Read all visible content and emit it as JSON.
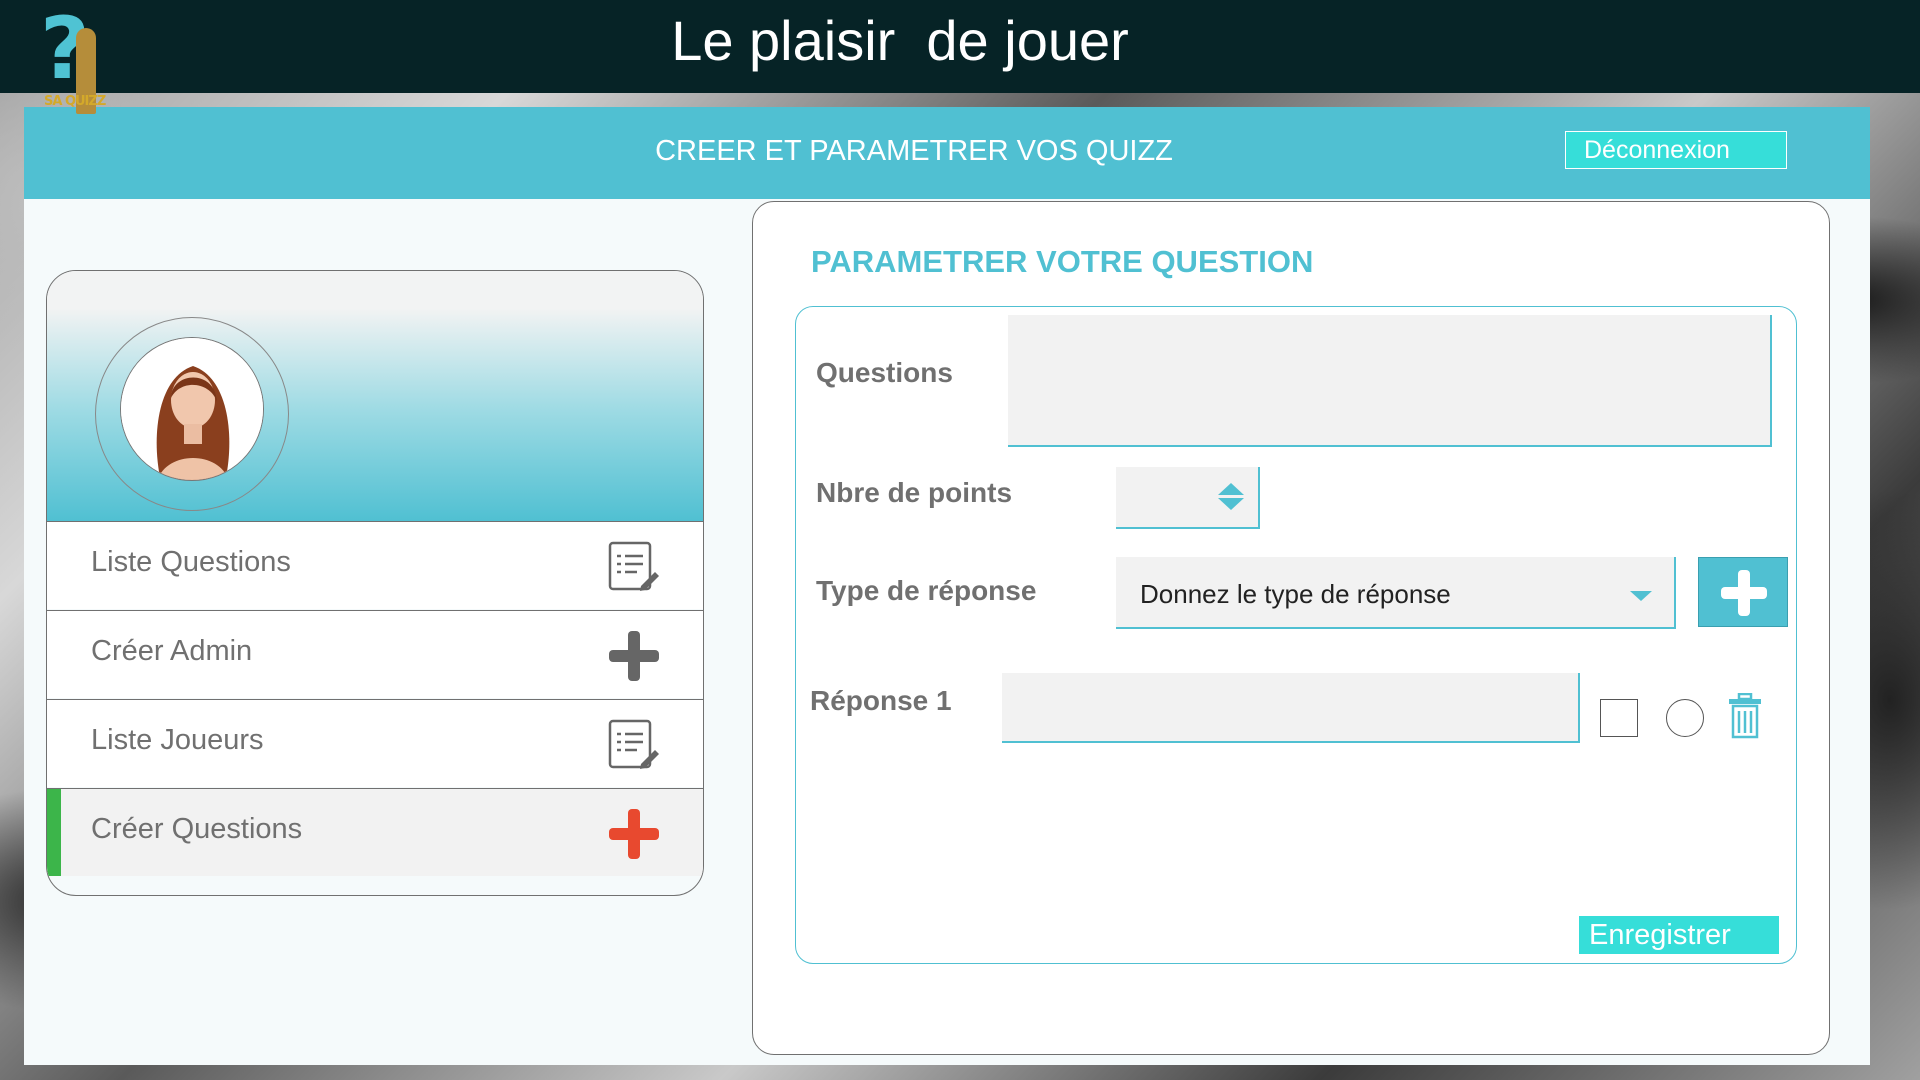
{
  "app": {
    "title": "Le plaisir  de jouer",
    "logo_text": "SA QUIZZ"
  },
  "header": {
    "title": "CREER ET PARAMETRER VOS QUIZZ",
    "logout_label": "Déconnexion"
  },
  "sidebar": {
    "items": [
      {
        "label": "Liste Questions",
        "icon": "list-edit-icon",
        "active": false
      },
      {
        "label": "Créer Admin",
        "icon": "plus-icon",
        "active": false
      },
      {
        "label": "Liste Joueurs",
        "icon": "list-edit-icon",
        "active": false
      },
      {
        "label": "Créer Questions",
        "icon": "plus-icon",
        "active": true
      }
    ]
  },
  "form": {
    "title": "PARAMETRER VOTRE QUESTION",
    "question_label": "Questions",
    "question_value": "",
    "points_label": "Nbre de points",
    "points_value": "",
    "type_label": "Type de réponse",
    "type_value": "Donnez le type de réponse",
    "answer_label": "Réponse 1",
    "answer_value": "",
    "save_label": "Enregistrer"
  },
  "colors": {
    "accent": "#50c0d2",
    "button": "#36ded9",
    "active_bar": "#3cb54a",
    "add_icon_active": "#e8492f",
    "topbar": "#062326"
  }
}
